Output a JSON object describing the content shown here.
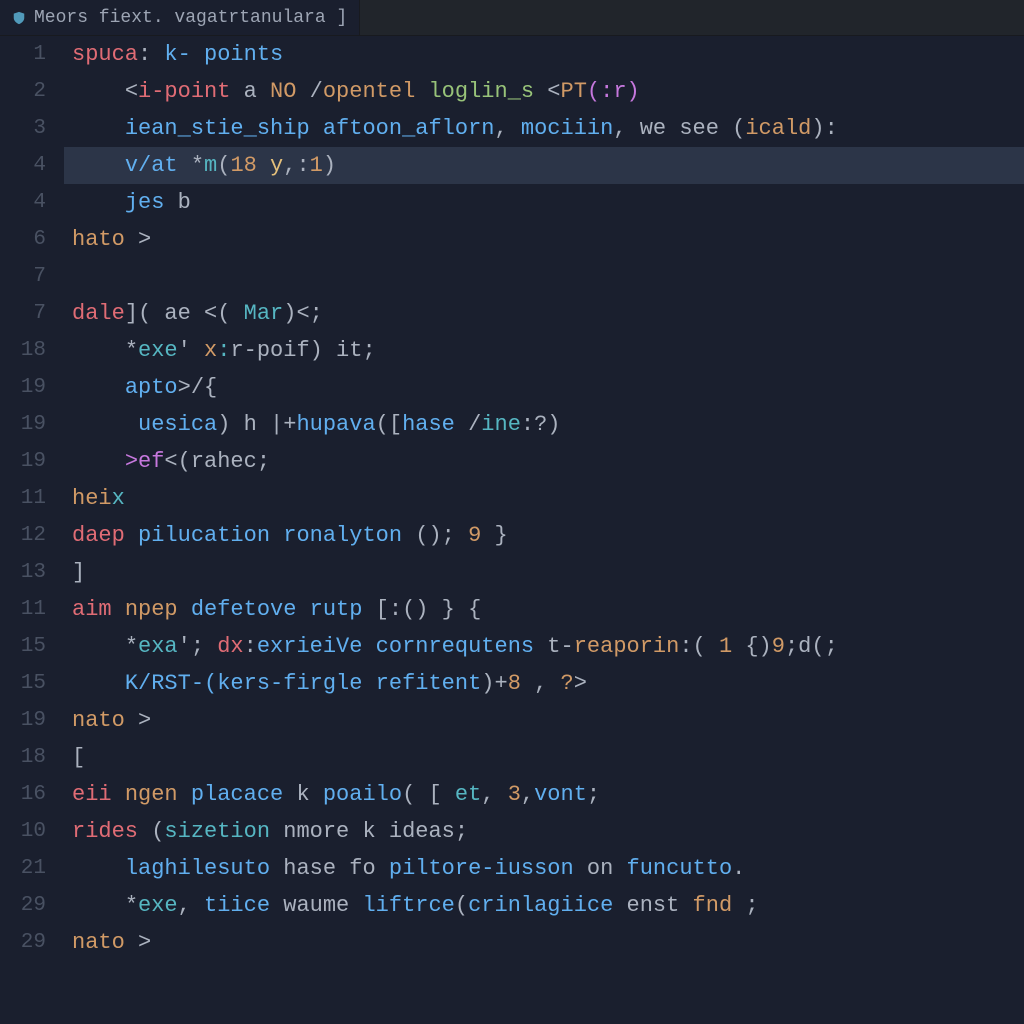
{
  "tab": {
    "filename": "Meors fiext. vagatrtanulara ]"
  },
  "gutter": [
    "1",
    "2",
    "3",
    "4",
    "4",
    "6",
    "7",
    "7",
    "18",
    "19",
    "19",
    "19",
    "11",
    "12",
    "13",
    "11",
    "15",
    "15",
    "19",
    "18",
    "16",
    "10",
    "21",
    "29",
    "29"
  ],
  "highlighted_line_index": 3,
  "code_lines": [
    [
      {
        "t": "spuca",
        "c": "kw-red"
      },
      {
        "t": ": ",
        "c": "kw-white"
      },
      {
        "t": "k- points",
        "c": "kw-blue"
      }
    ],
    [
      {
        "t": "    ",
        "c": "kw-white"
      },
      {
        "t": "<",
        "c": "kw-white"
      },
      {
        "t": "i-point",
        "c": "kw-red"
      },
      {
        "t": " a ",
        "c": "kw-white"
      },
      {
        "t": "NO",
        "c": "kw-orange"
      },
      {
        "t": " /",
        "c": "kw-white"
      },
      {
        "t": "opentel",
        "c": "kw-orange"
      },
      {
        "t": " ",
        "c": "kw-white"
      },
      {
        "t": "loglin_s",
        "c": "kw-green"
      },
      {
        "t": " <",
        "c": "kw-white"
      },
      {
        "t": "PT",
        "c": "kw-orange"
      },
      {
        "t": "(:r)",
        "c": "kw-purple"
      }
    ],
    [
      {
        "t": "    ",
        "c": "kw-white"
      },
      {
        "t": "iean_stie_ship",
        "c": "kw-blue"
      },
      {
        "t": " ",
        "c": "kw-white"
      },
      {
        "t": "aftoon_aflorn",
        "c": "kw-blue"
      },
      {
        "t": ", ",
        "c": "kw-white"
      },
      {
        "t": "mociiin",
        "c": "kw-blue"
      },
      {
        "t": ", we see (",
        "c": "kw-white"
      },
      {
        "t": "icald",
        "c": "kw-orange"
      },
      {
        "t": "):",
        "c": "kw-white"
      }
    ],
    [
      {
        "t": "    ",
        "c": "kw-white"
      },
      {
        "t": "v/at",
        "c": "kw-blue"
      },
      {
        "t": " *",
        "c": "kw-white"
      },
      {
        "t": "m",
        "c": "kw-cyan"
      },
      {
        "t": "(",
        "c": "kw-white"
      },
      {
        "t": "18",
        "c": "kw-num"
      },
      {
        "t": " ",
        "c": "kw-white"
      },
      {
        "t": "y",
        "c": "kw-yellow"
      },
      {
        "t": ",:",
        "c": "kw-white"
      },
      {
        "t": "1",
        "c": "kw-num"
      },
      {
        "t": ")",
        "c": "kw-white"
      }
    ],
    [
      {
        "t": "    ",
        "c": "kw-white"
      },
      {
        "t": "jes",
        "c": "kw-blue"
      },
      {
        "t": " b",
        "c": "kw-white"
      }
    ],
    [
      {
        "t": "hato",
        "c": "kw-orange"
      },
      {
        "t": " >",
        "c": "kw-white"
      }
    ],
    [
      {
        "t": " ",
        "c": "kw-white"
      }
    ],
    [
      {
        "t": "dale",
        "c": "kw-red"
      },
      {
        "t": "]( ae <( ",
        "c": "kw-white"
      },
      {
        "t": "Mar",
        "c": "kw-cyan"
      },
      {
        "t": ")<;",
        "c": "kw-white"
      }
    ],
    [
      {
        "t": "    ",
        "c": "kw-white"
      },
      {
        "t": "*",
        "c": "kw-white"
      },
      {
        "t": "exe",
        "c": "kw-cyan"
      },
      {
        "t": "' ",
        "c": "kw-white"
      },
      {
        "t": "x",
        "c": "kw-orange"
      },
      {
        "t": ":",
        "c": "kw-cyan"
      },
      {
        "t": "r-poif) it;",
        "c": "kw-white"
      }
    ],
    [
      {
        "t": "    ",
        "c": "kw-white"
      },
      {
        "t": "apto",
        "c": "kw-blue"
      },
      {
        "t": ">/{",
        "c": "kw-white"
      }
    ],
    [
      {
        "t": "     ",
        "c": "kw-white"
      },
      {
        "t": "uesica",
        "c": "kw-blue"
      },
      {
        "t": ") h |+",
        "c": "kw-white"
      },
      {
        "t": "hupava",
        "c": "kw-blue"
      },
      {
        "t": "([",
        "c": "kw-white"
      },
      {
        "t": "hase",
        "c": "kw-blue"
      },
      {
        "t": " /",
        "c": "kw-white"
      },
      {
        "t": "ine",
        "c": "kw-cyan"
      },
      {
        "t": ":?)",
        "c": "kw-white"
      }
    ],
    [
      {
        "t": "    ",
        "c": "kw-white"
      },
      {
        "t": ">ef",
        "c": "kw-purple"
      },
      {
        "t": "<(rahec;",
        "c": "kw-white"
      }
    ],
    [
      {
        "t": "hei",
        "c": "kw-orange"
      },
      {
        "t": "x",
        "c": "kw-cyan"
      }
    ],
    [
      {
        "t": "daep",
        "c": "kw-red"
      },
      {
        "t": " ",
        "c": "kw-white"
      },
      {
        "t": "pilucation ronalyton",
        "c": "kw-blue"
      },
      {
        "t": " (); ",
        "c": "kw-white"
      },
      {
        "t": "9",
        "c": "kw-num"
      },
      {
        "t": " }",
        "c": "kw-white"
      }
    ],
    [
      {
        "t": "]",
        "c": "kw-white"
      }
    ],
    [
      {
        "t": "aim",
        "c": "kw-red"
      },
      {
        "t": " ",
        "c": "kw-white"
      },
      {
        "t": "npep",
        "c": "kw-orange"
      },
      {
        "t": " ",
        "c": "kw-white"
      },
      {
        "t": "defetove rutp",
        "c": "kw-blue"
      },
      {
        "t": " [:() } {",
        "c": "kw-white"
      }
    ],
    [
      {
        "t": "    ",
        "c": "kw-white"
      },
      {
        "t": "*",
        "c": "kw-white"
      },
      {
        "t": "exa",
        "c": "kw-cyan"
      },
      {
        "t": "';",
        "c": "kw-white"
      },
      {
        "t": " dx",
        "c": "kw-red"
      },
      {
        "t": ":",
        "c": "kw-white"
      },
      {
        "t": "exrieiVe",
        "c": "kw-blue"
      },
      {
        "t": " ",
        "c": "kw-white"
      },
      {
        "t": "cornrequtens",
        "c": "kw-blue"
      },
      {
        "t": " t-",
        "c": "kw-white"
      },
      {
        "t": "reaporin",
        "c": "kw-orange"
      },
      {
        "t": ":( ",
        "c": "kw-white"
      },
      {
        "t": "1",
        "c": "kw-num"
      },
      {
        "t": " {)",
        "c": "kw-white"
      },
      {
        "t": "9",
        "c": "kw-num"
      },
      {
        "t": ";d(;",
        "c": "kw-white"
      }
    ],
    [
      {
        "t": "    ",
        "c": "kw-white"
      },
      {
        "t": "K/RST-(",
        "c": "kw-blue"
      },
      {
        "t": "kers-firgle refitent",
        "c": "kw-blue"
      },
      {
        "t": ")+",
        "c": "kw-white"
      },
      {
        "t": "8",
        "c": "kw-num"
      },
      {
        "t": " , ",
        "c": "kw-white"
      },
      {
        "t": "?",
        "c": "kw-orange"
      },
      {
        "t": ">",
        "c": "kw-white"
      }
    ],
    [
      {
        "t": "nato",
        "c": "kw-orange"
      },
      {
        "t": " >",
        "c": "kw-white"
      }
    ],
    [
      {
        "t": "[",
        "c": "kw-white"
      }
    ],
    [
      {
        "t": "eii",
        "c": "kw-red"
      },
      {
        "t": " ",
        "c": "kw-white"
      },
      {
        "t": "ngen",
        "c": "kw-orange"
      },
      {
        "t": " ",
        "c": "kw-white"
      },
      {
        "t": "placace",
        "c": "kw-blue"
      },
      {
        "t": " k ",
        "c": "kw-white"
      },
      {
        "t": "poailo",
        "c": "kw-blue"
      },
      {
        "t": "( [ ",
        "c": "kw-white"
      },
      {
        "t": "et",
        "c": "kw-cyan"
      },
      {
        "t": ", ",
        "c": "kw-white"
      },
      {
        "t": "3",
        "c": "kw-num"
      },
      {
        "t": ",",
        "c": "kw-white"
      },
      {
        "t": "vont",
        "c": "kw-blue"
      },
      {
        "t": ";",
        "c": "kw-white"
      }
    ],
    [
      {
        "t": "rides",
        "c": "kw-red"
      },
      {
        "t": " (",
        "c": "kw-white"
      },
      {
        "t": "sizetion",
        "c": "kw-cyan"
      },
      {
        "t": " nmore k ideas;",
        "c": "kw-white"
      }
    ],
    [
      {
        "t": "    ",
        "c": "kw-white"
      },
      {
        "t": "laghilesuto",
        "c": "kw-blue"
      },
      {
        "t": " hase fo ",
        "c": "kw-white"
      },
      {
        "t": "piltore-iusson",
        "c": "kw-blue"
      },
      {
        "t": " on ",
        "c": "kw-white"
      },
      {
        "t": "funcutto",
        "c": "kw-blue"
      },
      {
        "t": ".",
        "c": "kw-white"
      }
    ],
    [
      {
        "t": "    ",
        "c": "kw-white"
      },
      {
        "t": "*",
        "c": "kw-white"
      },
      {
        "t": "exe",
        "c": "kw-cyan"
      },
      {
        "t": ", ",
        "c": "kw-white"
      },
      {
        "t": "tiice",
        "c": "kw-blue"
      },
      {
        "t": " waume ",
        "c": "kw-white"
      },
      {
        "t": "liftrce",
        "c": "kw-blue"
      },
      {
        "t": "(",
        "c": "kw-white"
      },
      {
        "t": "crinlagiice",
        "c": "kw-blue"
      },
      {
        "t": " enst ",
        "c": "kw-white"
      },
      {
        "t": "fnd",
        "c": "kw-orange"
      },
      {
        "t": " ;",
        "c": "kw-white"
      }
    ],
    [
      {
        "t": "nato",
        "c": "kw-orange"
      },
      {
        "t": " >",
        "c": "kw-white"
      }
    ]
  ]
}
